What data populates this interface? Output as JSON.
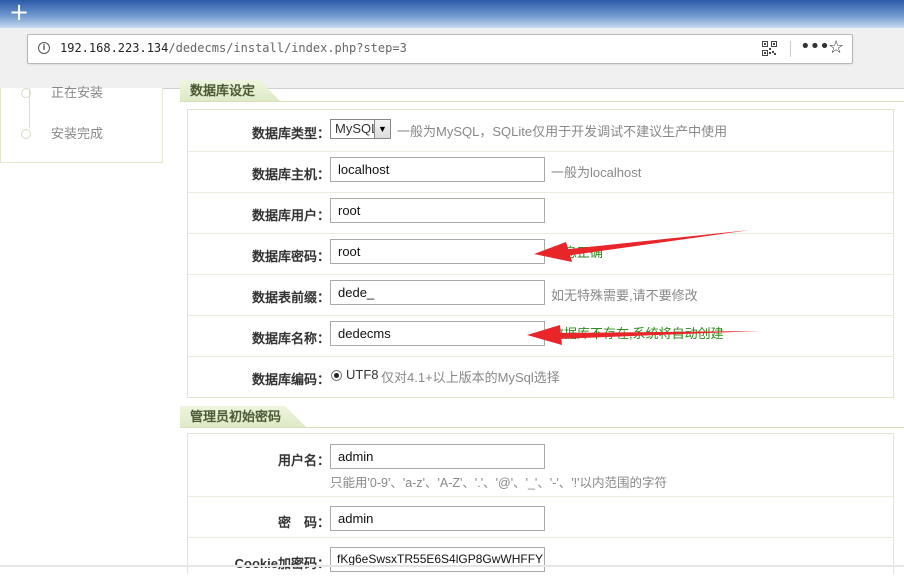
{
  "browser": {
    "new_tab_glyph": "+",
    "url_host": "192.168.223.134",
    "url_path": "/dedecms/install/index.php?step=3",
    "icons": [
      "info-icon",
      "qr-code-icon",
      "more-icon",
      "bookmark-star-icon"
    ]
  },
  "steps": {
    "items": [
      {
        "label": "正在安装"
      },
      {
        "label": "安装完成"
      }
    ]
  },
  "db_section": {
    "title": "数据库设定",
    "rows": [
      {
        "label": "数据库类型：",
        "select_value": "MySQL",
        "hint": "一般为MySQL，SQLite仅用于开发调试不建议生产中使用"
      },
      {
        "label": "数据库主机：",
        "value": "localhost",
        "hint": "一般为localhost"
      },
      {
        "label": "数据库用户：",
        "value": "root",
        "hint": ""
      },
      {
        "label": "数据库密码：",
        "value": "root",
        "hint": "信息正确"
      },
      {
        "label": "数据表前缀：",
        "value": "dede_",
        "hint": "如无特殊需要,请不要修改"
      },
      {
        "label": "数据库名称：",
        "value": "dedecms",
        "hint": "数据库不存在,系统将自动创建"
      },
      {
        "label": "数据库编码：",
        "radio_label": "UTF8",
        "hint": "仅对4.1+以上版本的MySql选择"
      }
    ]
  },
  "admin_section": {
    "title": "管理员初始密码",
    "rows": [
      {
        "label": "用户名：",
        "value": "admin",
        "hint": "只能用'0-9'、'a-z'、'A-Z'、'.'、'@'、'_'、'-'、'!'以内范围的字符"
      },
      {
        "label": "密　码：",
        "value": "admin"
      },
      {
        "label": "Cookie加密码：",
        "value": "fKg6eSwsxTR55E6S4lGP8GwWHFFY"
      }
    ]
  },
  "colors": {
    "ok_hint": "#2e8a1e",
    "annotation_arrow": "#e8262a",
    "section_tab": "#dde9c4"
  }
}
